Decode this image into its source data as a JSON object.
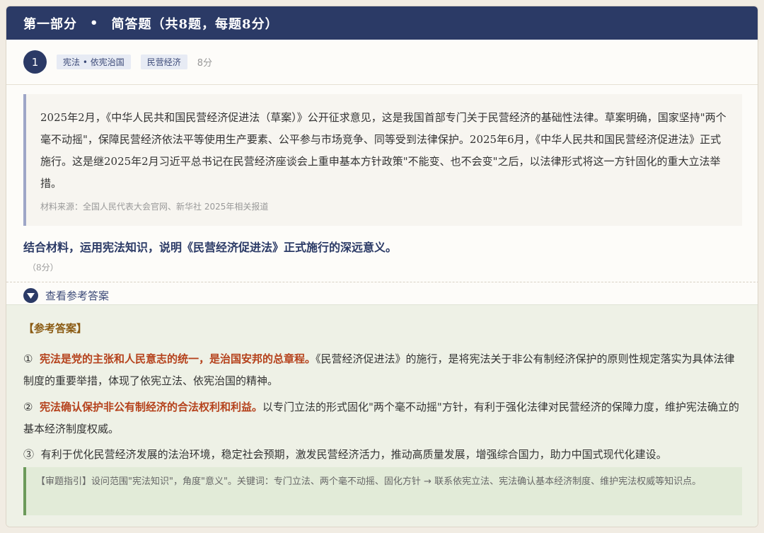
{
  "section": {
    "title_part": "第一部分",
    "dot": "•",
    "title_desc": "简答题（共8题，每题8分）"
  },
  "question": {
    "number": "1",
    "tags": [
      "宪法 • 依宪治国",
      "民营经济"
    ],
    "score": "8分",
    "material": "2025年2月，《中华人民共和国民营经济促进法（草案）》公开征求意见，这是我国首部专门关于民营经济的基础性法律。草案明确，国家坚持\"两个毫不动摇\"，保障民营经济依法平等使用生产要素、公平参与市场竞争、同等受到法律保护。2025年6月，《中华人民共和国民营经济促进法》正式施行。这是继2025年2月习近平总书记在民营经济座谈会上重申基本方针政策\"不能变、也不会变\"之后，以法律形式将这一方针固化的重大立法举措。",
    "source": "材料来源：全国人民代表大会官网、新华社 2025年相关报道",
    "prompt": "结合材料，运用宪法知识，说明《民营经济促进法》正式施行的深远意义。",
    "prompt_score": "（8分）",
    "toggle_label": "查看参考答案"
  },
  "answer": {
    "title": "【参考答案】",
    "items": [
      {
        "num": "①",
        "highlight": "宪法是党的主张和人民意志的统一，是治国安邦的总章程。",
        "text": "《民营经济促进法》的施行，是将宪法关于非公有制经济保护的原则性规定落实为具体法律制度的重要举措，体现了依宪立法、依宪治国的精神。"
      },
      {
        "num": "②",
        "highlight": "宪法确认保护非公有制经济的合法权利和利益。",
        "text": "以专门立法的形式固化\"两个毫不动摇\"方针，有利于强化法律对民营经济的保障力度，维护宪法确立的基本经济制度权威。"
      },
      {
        "num": "③",
        "highlight": "",
        "text": "有利于优化民营经济发展的法治环境，稳定社会预期，激发民营经济活力，推动高质量发展，增强综合国力，助力中国式现代化建设。"
      }
    ],
    "hint": "【审题指引】设问范围\"宪法知识\"，角度\"意义\"。关键词：专门立法、两个毫不动摇、固化方针 → 联系依宪立法、宪法确认基本经济制度、维护宪法权威等知识点。"
  }
}
